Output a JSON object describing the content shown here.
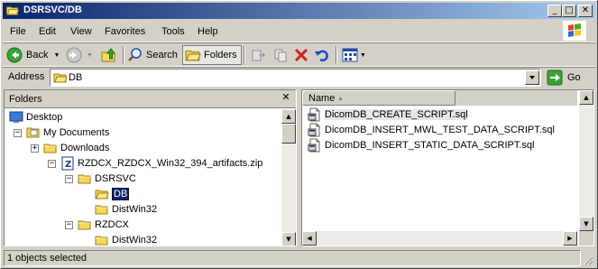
{
  "window": {
    "title": "DSRSVC/DB"
  },
  "menu": [
    "File",
    "Edit",
    "View",
    "Favorites",
    "Tools",
    "Help"
  ],
  "toolbar": {
    "back_label": "Back",
    "search_label": "Search",
    "folders_label": "Folders"
  },
  "address": {
    "label": "Address",
    "value": "DB",
    "go_label": "Go"
  },
  "folders_pane": {
    "title": "Folders",
    "tree": [
      {
        "label": "Desktop",
        "icon": "desktop-icon",
        "expander": ""
      },
      {
        "label": "My Documents",
        "icon": "my-documents-icon",
        "expander": "-"
      },
      {
        "label": "Downloads",
        "icon": "folder-icon",
        "expander": "+"
      },
      {
        "label": "RZDCX_RZDCX_Win32_394_artifacts.zip",
        "icon": "zip-folder-icon",
        "expander": "-"
      },
      {
        "label": "DSRSVC",
        "icon": "folder-icon",
        "expander": "-"
      },
      {
        "label": "DB",
        "icon": "folder-open-icon",
        "expander": "",
        "selected": true
      },
      {
        "label": "DistWin32",
        "icon": "folder-icon",
        "expander": ""
      },
      {
        "label": "RZDCX",
        "icon": "folder-icon",
        "expander": "-"
      },
      {
        "label": "DistWin32",
        "icon": "folder-icon",
        "expander": ""
      }
    ]
  },
  "files_pane": {
    "column_name": "Name",
    "files": [
      {
        "name": "DicomDB_CREATE_SCRIPT.sql",
        "icon": "sql-file-icon"
      },
      {
        "name": "DicomDB_INSERT_MWL_TEST_DATA_SCRIPT.sql",
        "icon": "sql-file-icon"
      },
      {
        "name": "DicomDB_INSERT_STATIC_DATA_SCRIPT.sql",
        "icon": "sql-file-icon"
      }
    ]
  },
  "status": {
    "text": "1 objects selected"
  },
  "colors": {
    "title_start": "#0a246a",
    "title_end": "#a6caf0",
    "face": "#d4d0c8",
    "folder": "#f5d75c"
  }
}
